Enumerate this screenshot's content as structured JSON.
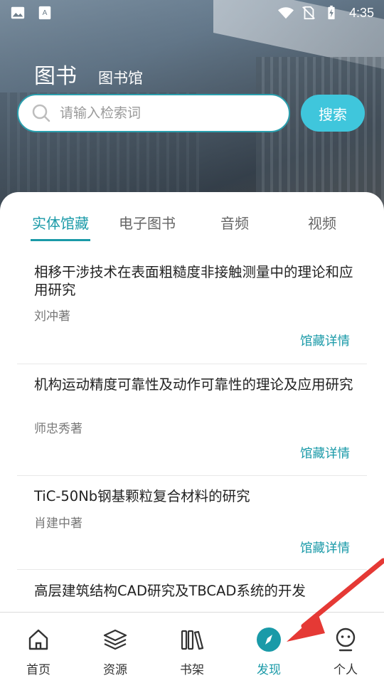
{
  "status_bar": {
    "time": "4:35"
  },
  "header": {
    "title": "图书",
    "subtitle": "图书馆"
  },
  "search": {
    "placeholder": "请输入检索词",
    "button_label": "搜索"
  },
  "tabs": [
    {
      "label": "实体馆藏",
      "active": true
    },
    {
      "label": "电子图书",
      "active": false
    },
    {
      "label": "音频",
      "active": false
    },
    {
      "label": "视频",
      "active": false
    }
  ],
  "books": [
    {
      "title": "相移干涉技术在表面粗糙度非接触测量中的理论和应用研究",
      "author": "刘冲著",
      "detail_label": "馆藏详情"
    },
    {
      "title": "机构运动精度可靠性及动作可靠性的理论及应用研究",
      "author": "师忠秀著",
      "detail_label": "馆藏详情"
    },
    {
      "title": "TiC-50Nb钢基颗粒复合材料的研究",
      "author": "肖建中著",
      "detail_label": "馆藏详情"
    },
    {
      "title": "高层建筑结构CAD研究及TBCAD系统的开发"
    }
  ],
  "bottom_nav": [
    {
      "label": "首页",
      "icon": "home-icon",
      "active": false
    },
    {
      "label": "资源",
      "icon": "layers-icon",
      "active": false
    },
    {
      "label": "书架",
      "icon": "bookshelf-icon",
      "active": false
    },
    {
      "label": "发现",
      "icon": "compass-icon",
      "active": true
    },
    {
      "label": "个人",
      "icon": "person-icon",
      "active": false
    }
  ],
  "colors": {
    "accent": "#1a9aa8",
    "search_button": "#3fc6dc",
    "annotation_arrow": "#e53935"
  }
}
